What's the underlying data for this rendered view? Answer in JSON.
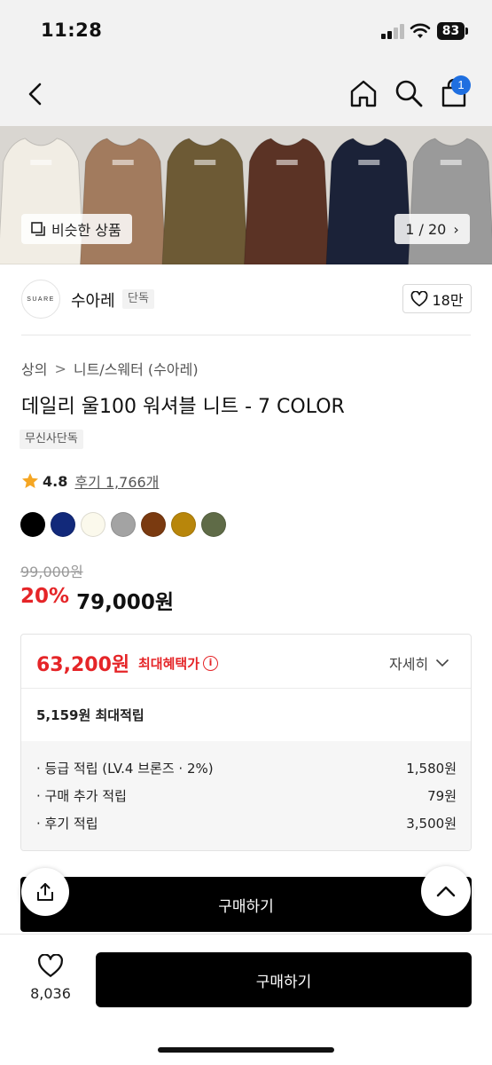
{
  "status": {
    "time": "11:28",
    "battery": "83"
  },
  "nav": {
    "cart_count": "1"
  },
  "hero": {
    "similar_label": "비슷한 상품",
    "counter": "1 / 20",
    "sweater_colors": [
      "#f1ede4",
      "#a27b5e",
      "#6d5a35",
      "#5b3325",
      "#1b2238",
      "#9a9a9a"
    ]
  },
  "brand": {
    "logo_text": "SUARE",
    "name": "수아레",
    "tag": "단독",
    "likes": "18만"
  },
  "product": {
    "breadcrumb": [
      "상의",
      "니트/스웨터 (수아레)"
    ],
    "title": "데일리 울100 워셔블 니트 - 7 COLOR",
    "exclusive_tag": "무신사단독",
    "rating": "4.8",
    "review_text": "후기 1,766개",
    "colors": [
      "#000000",
      "#12297a",
      "#fbf9ec",
      "#a3a3a3",
      "#7a3a10",
      "#b8860b",
      "#5f6b47"
    ],
    "original_price": "99,000원",
    "discount": "20%",
    "sale_price": "79,000원"
  },
  "benefit": {
    "max_price": "63,200원",
    "max_label": "최대혜택가",
    "detail_label": "자세히",
    "max_points": "5,159원 최대적립",
    "rows": [
      {
        "label": "· 등급 적립 (LV.4 브론즈 · 2%)",
        "value": "1,580원"
      },
      {
        "label": "· 구매 추가 적립",
        "value": "79원"
      },
      {
        "label": "· 후기 적립",
        "value": "3,500원"
      }
    ]
  },
  "actions": {
    "buy_strip_label": "구매하기",
    "wish_count": "8,036",
    "buy_label": "구매하기"
  }
}
